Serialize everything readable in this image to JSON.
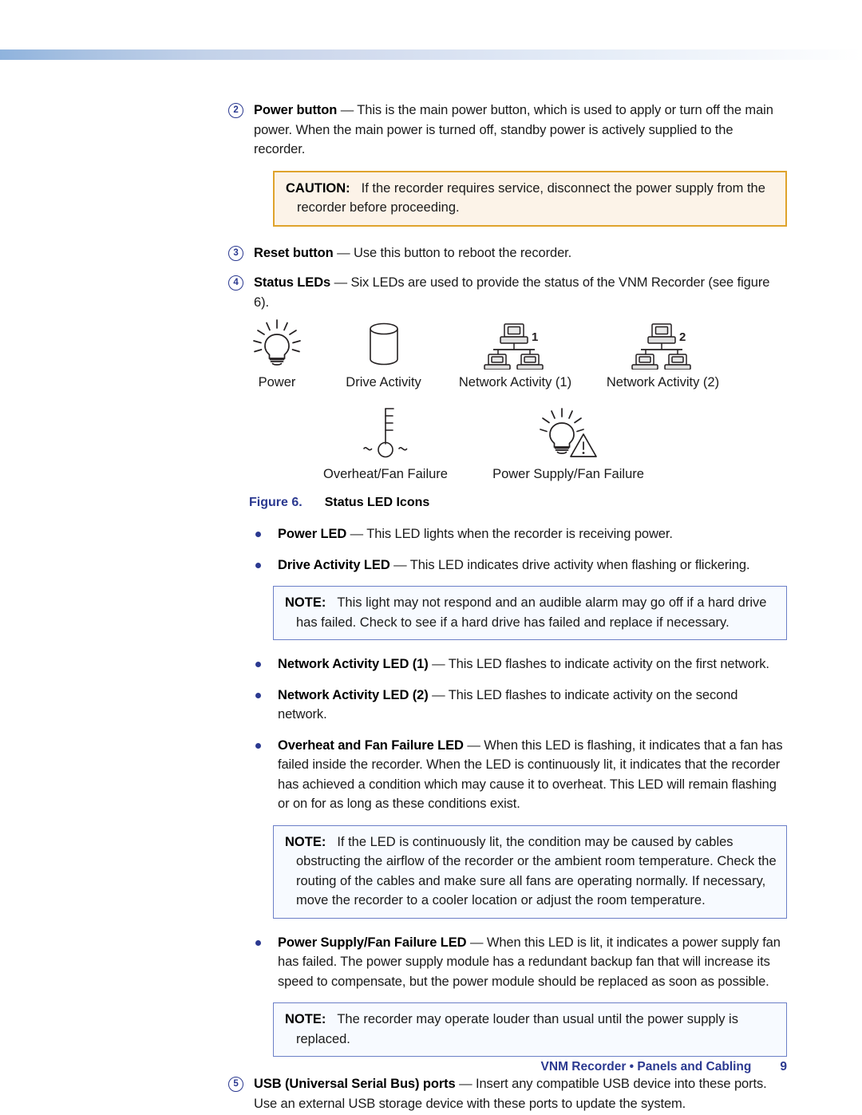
{
  "document": {
    "footer_text": "VNM Recorder • Panels and Cabling",
    "page_number": "9"
  },
  "colors": {
    "accent_blue": "#2b3990",
    "caution_border": "#dfa32c",
    "caution_fill": "#fcf3e8",
    "note_border": "#6b7fc7",
    "note_fill": "#f7faff"
  },
  "items": [
    {
      "number": "2",
      "lead": "Power button",
      "dash": " — ",
      "text": "This is the main power button, which is used to apply or turn off the main power. When the main power is turned off, standby power is actively supplied to the recorder."
    },
    {
      "number": "3",
      "lead": "Reset button",
      "dash": " — ",
      "text": "Use this button to reboot the recorder."
    },
    {
      "number": "4",
      "lead": "Status LEDs",
      "dash": " — ",
      "text": "Six LEDs are used to provide the status of the VNM Recorder (see figure 6)."
    },
    {
      "number": "5",
      "lead": "USB (Universal Serial Bus) ports",
      "dash": " — ",
      "text": "Insert any compatible USB device into these ports. Use an external USB storage device with these ports to update the system."
    }
  ],
  "caution_1": {
    "keyword": "CAUTION:",
    "text": "If the recorder requires service, disconnect the power supply from the recorder before proceeding."
  },
  "figure": {
    "caption_number": "Figure 6.",
    "caption_title": "Status LED Icons",
    "icons_row1": [
      {
        "icon": "lightbulb-icon",
        "label": "Power"
      },
      {
        "icon": "drive-cylinder-icon",
        "label": "Drive Activity"
      },
      {
        "icon": "network-icon-1",
        "badge": "1",
        "label": "Network Activity (1)"
      },
      {
        "icon": "network-icon-2",
        "badge": "2",
        "label": "Network Activity (2)"
      }
    ],
    "icons_row2": [
      {
        "icon": "thermometer-icon",
        "label": "Overheat/Fan Failure"
      },
      {
        "icon": "lightbulb-warning-icon",
        "label": "Power Supply/Fan Failure"
      }
    ]
  },
  "bullets": [
    {
      "lead": "Power LED",
      "dash": " — ",
      "text": "This LED lights when the recorder is receiving power."
    },
    {
      "lead": "Drive Activity LED",
      "dash": " — ",
      "text": "This LED indicates drive activity when flashing or flickering."
    },
    {
      "lead": "Network Activity LED (1)",
      "dash": " — ",
      "text": "This LED flashes to indicate activity on the first network."
    },
    {
      "lead": "Network Activity LED (2)",
      "dash": " — ",
      "text": "This LED flashes to indicate activity on the second network."
    },
    {
      "lead": "Overheat and Fan Failure LED",
      "dash": " — ",
      "text": "When this LED is flashing, it indicates that a fan has failed inside the recorder. When the LED is continuously lit, it indicates that the recorder has achieved a condition which may cause it to overheat. This LED will remain flashing or on for as long as these conditions exist."
    },
    {
      "lead": "Power Supply/Fan Failure LED",
      "dash": " — ",
      "text": "When this LED is lit, it indicates a power supply fan has failed. The power supply module has a redundant backup fan that will increase its speed to compensate, but the power module should be replaced as soon as possible."
    }
  ],
  "note_1": {
    "keyword": "NOTE:",
    "text": "This light may not respond and an audible alarm may go off if a hard drive has failed. Check to see if a hard drive has failed and replace if necessary."
  },
  "note_2": {
    "keyword": "NOTE:",
    "text": "If the LED is continuously lit, the condition may be caused by cables obstructing the airflow of the recorder or the ambient room temperature. Check the routing of the cables and make sure all fans are operating normally. If necessary, move the recorder to a cooler location or adjust the room temperature."
  },
  "note_3": {
    "keyword": "NOTE:",
    "text": "The recorder may operate louder than usual until the power supply is replaced."
  }
}
